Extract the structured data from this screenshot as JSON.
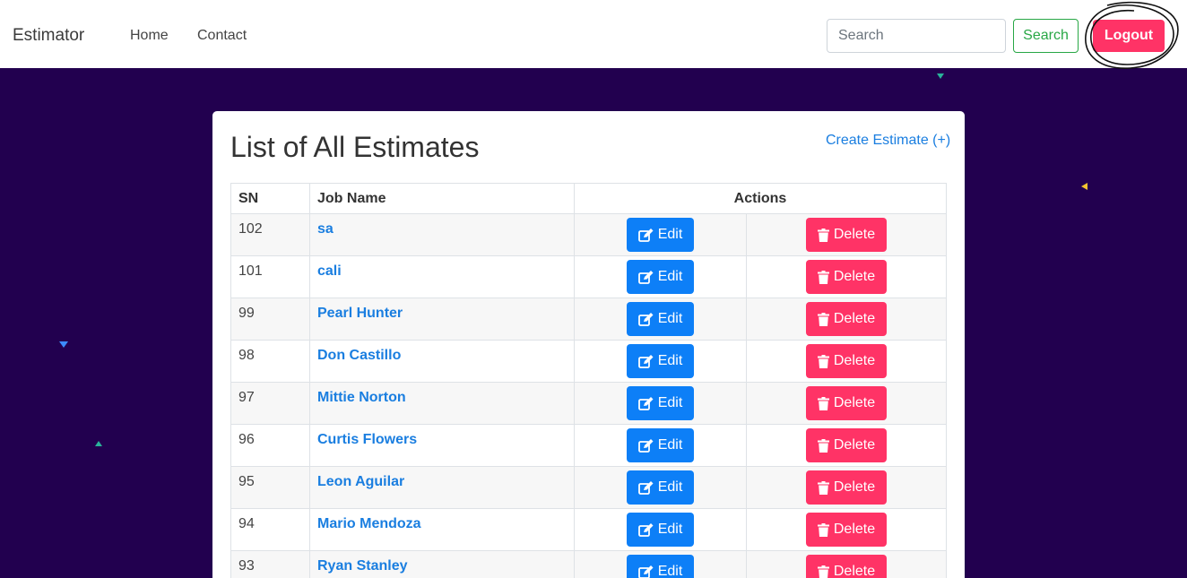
{
  "navbar": {
    "brand": "Estimator",
    "links": [
      "Home",
      "Contact"
    ],
    "search_placeholder": "Search",
    "search_button": "Search",
    "logout_button": "Logout"
  },
  "colors": {
    "background": "#22004f",
    "primary": "#0d7ff7",
    "danger": "#ff3366",
    "success": "#28a745",
    "link": "#1a7ee0"
  },
  "main": {
    "title": "List of All Estimates",
    "create_link": "Create Estimate (+)",
    "table": {
      "headers": [
        "SN",
        "Job Name",
        "Actions"
      ],
      "edit_label": "Edit",
      "delete_label": "Delete",
      "edit_icon": "edit-icon",
      "delete_icon": "trash-icon",
      "rows": [
        {
          "sn": "102",
          "job": "sa"
        },
        {
          "sn": "101",
          "job": "cali"
        },
        {
          "sn": "99",
          "job": "Pearl Hunter"
        },
        {
          "sn": "98",
          "job": "Don Castillo"
        },
        {
          "sn": "97",
          "job": "Mittie Norton"
        },
        {
          "sn": "96",
          "job": "Curtis Flowers"
        },
        {
          "sn": "95",
          "job": "Leon Aguilar"
        },
        {
          "sn": "94",
          "job": "Mario Mendoza"
        },
        {
          "sn": "93",
          "job": "Ryan Stanley"
        }
      ]
    }
  }
}
